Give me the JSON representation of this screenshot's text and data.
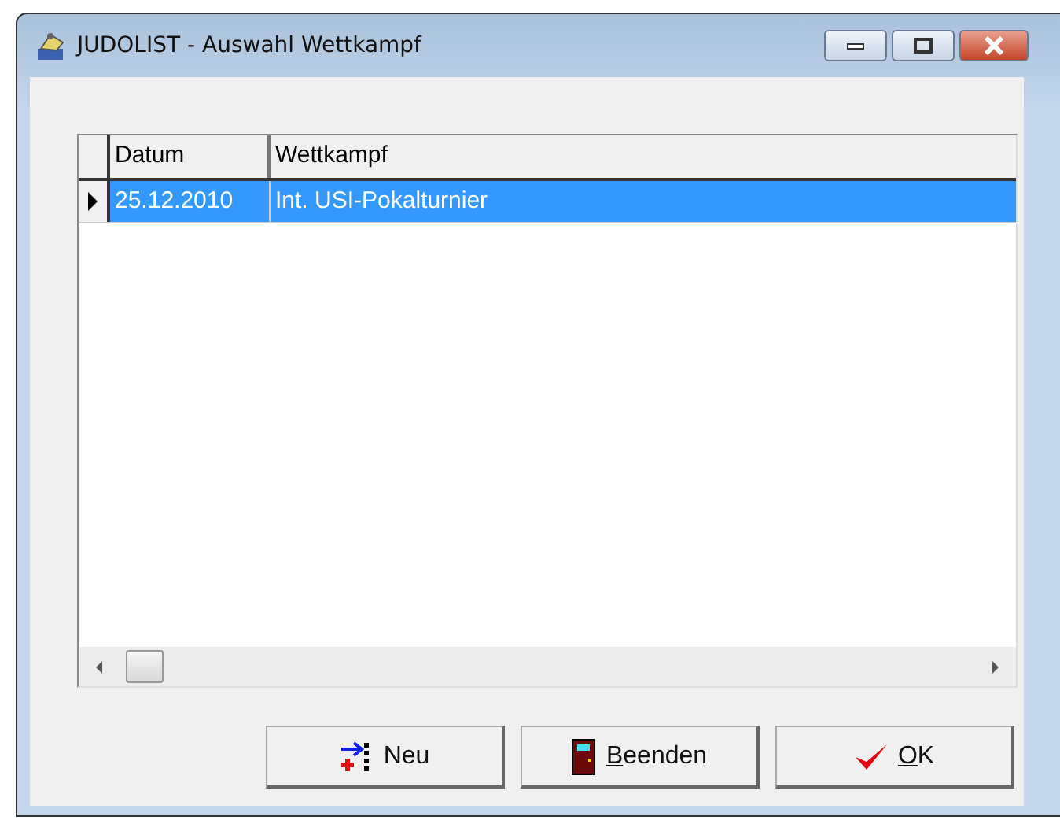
{
  "window": {
    "title": "JUDOLIST - Auswahl Wettkampf"
  },
  "table": {
    "columns": [
      "Datum",
      "Wettkampf"
    ],
    "rows": [
      {
        "cells": [
          "25.12.2010",
          "Int. USI-Pokalturnier"
        ],
        "selected": true
      }
    ]
  },
  "buttons": [
    {
      "kind": "new",
      "rest": "Neu"
    },
    {
      "kind": "exit",
      "mnemonic": "B",
      "rest": "eenden"
    },
    {
      "kind": "ok",
      "mnemonic": "O",
      "rest": "K"
    }
  ]
}
